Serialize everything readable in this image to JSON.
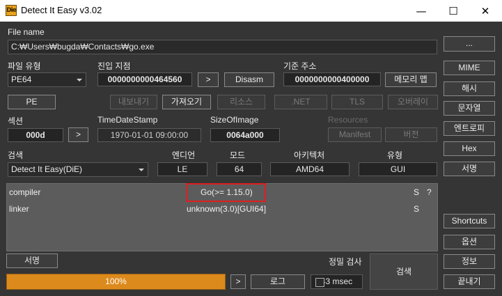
{
  "window": {
    "title": "Detect It Easy v3.02",
    "icon_text": "Die",
    "minimize_glyph": "—",
    "maximize_glyph": "☐",
    "close_glyph": "✕"
  },
  "file": {
    "label": "File name",
    "path": "C:₩Users₩bugda₩Contacts₩go.exe",
    "browse_label": "..."
  },
  "pe_type": {
    "label": "파일 유형",
    "value": "PE64"
  },
  "entry_point": {
    "label": "진입 지점",
    "value": "0000000000464560",
    "arrow": ">",
    "disasm_label": "Disasm"
  },
  "base_address": {
    "label": "기준 주소",
    "value": "0000000000400000",
    "memory_map_label": "메모리 맵"
  },
  "toolbar": {
    "pe_label": "PE",
    "export_label": "내보내기",
    "import_label": "가져오기",
    "resources_label": "리소스",
    "net_label": ".NET",
    "tls_label": "TLS",
    "overlay_label": "오버레이"
  },
  "sections": {
    "label": "섹션",
    "value": "000d",
    "arrow": ">"
  },
  "timestamp": {
    "label": "TimeDateStamp",
    "value": "1970-01-01 09:00:00"
  },
  "size_of_image": {
    "label": "SizeOfImage",
    "value": "0064a000"
  },
  "resources_group": {
    "label": "Resources",
    "manifest_label": "Manifest",
    "version_label": "버전"
  },
  "search": {
    "label": "검색",
    "engine": "Detect It Easy(DiE)"
  },
  "info": {
    "endian_label": "엔디언",
    "endian": "LE",
    "mode_label": "모드",
    "mode": "64",
    "arch_label": "아키텍처",
    "arch": "AMD64",
    "type_label": "유형",
    "type": "GUI"
  },
  "results": [
    {
      "type": "compiler",
      "name": "Go(>= 1.15.0)",
      "flag": "S",
      "extra": "?"
    },
    {
      "type": "linker",
      "name": "unknown(3.0)[GUI64]",
      "flag": "S",
      "extra": ""
    }
  ],
  "bottom": {
    "signature_label": "서명",
    "progress_text": "100%",
    "progress_fraction": 1.0,
    "arrow": ">",
    "log_label": "로그",
    "elapsed": "43 msec",
    "deep_scan_label": "정밀 검사",
    "scan_label": "검색"
  },
  "side_buttons": {
    "mime": "MIME",
    "hash": "해시",
    "strings": "문자열",
    "entropy": "엔트로피",
    "hex": "Hex",
    "signatures": "서명",
    "shortcuts": "Shortcuts",
    "options": "옵션",
    "about": "정보",
    "exit": "끝내기"
  }
}
